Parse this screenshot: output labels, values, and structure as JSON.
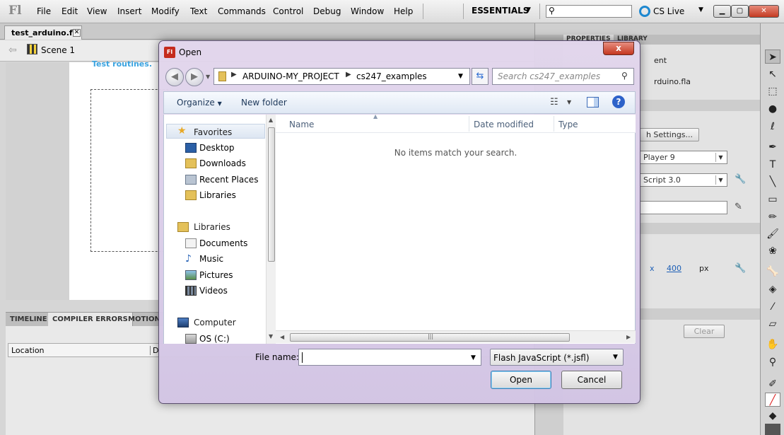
{
  "app": {
    "logo": "Fl",
    "menu": [
      "File",
      "Edit",
      "View",
      "Insert",
      "Modify",
      "Text",
      "Commands",
      "Control",
      "Debug",
      "Window",
      "Help"
    ],
    "workspace": "ESSENTIALS",
    "cs_live": "CS Live",
    "doc_tab": "test_arduino.fla",
    "scene": "Scene 1",
    "stage_text": "Test routines."
  },
  "panels": {
    "timeline_tabs": [
      "TIMELINE",
      "COMPILER ERRORS",
      "MOTION"
    ],
    "error_columns": [
      "Location",
      "D"
    ],
    "properties_tabs": [
      "PROPERTIES",
      "LIBRARY"
    ],
    "properties": {
      "doc_kind_fragment": "ent",
      "file_name_fragment": "rduino.fla",
      "publish_settings": "h Settings...",
      "player": "Player 9",
      "script": "Script 3.0",
      "x_label": "x",
      "x_value": "400",
      "px": "px",
      "clear": "Clear"
    }
  },
  "dialog": {
    "title_icon": "Fl",
    "title": "Open",
    "close_glyph": "x",
    "breadcrumbs": [
      "ARDUINO-MY_PROJECT",
      "cs247_examples"
    ],
    "search_placeholder": "Search cs247_examples",
    "toolbar": {
      "organize": "Organize",
      "new_folder": "New folder"
    },
    "nav": {
      "favorites": "Favorites",
      "favorites_items": [
        "Desktop",
        "Downloads",
        "Recent Places",
        "Libraries"
      ],
      "libraries": "Libraries",
      "libraries_items": [
        "Documents",
        "Music",
        "Pictures",
        "Videos"
      ],
      "computer": "Computer",
      "computer_items": [
        "OS (C:)"
      ]
    },
    "columns": [
      "Name",
      "Date modified",
      "Type"
    ],
    "empty_message": "No items match your search.",
    "file_name_label": "File name:",
    "file_name_value": "",
    "file_type": "Flash JavaScript (*.jsfl)",
    "open_button": "Open",
    "cancel_button": "Cancel"
  }
}
